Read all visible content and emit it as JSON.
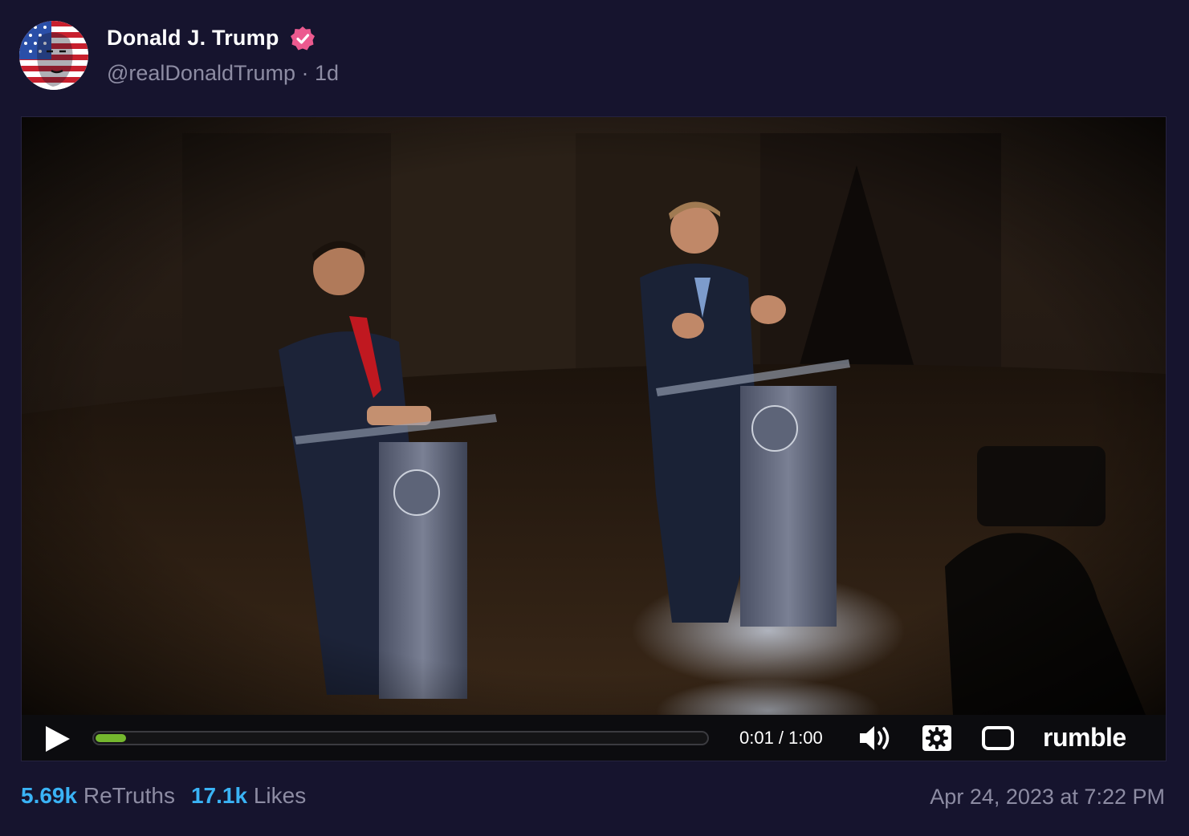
{
  "post": {
    "author": {
      "display_name": "Donald J. Trump",
      "handle": "@realDonaldTrump",
      "time_ago": "1d",
      "separator": "·",
      "verified": true,
      "verified_color": "#ec5a8f",
      "avatar_icon": "flag-face-avatar"
    },
    "video": {
      "current_time": "0:01",
      "duration": "1:00",
      "time_separator": "/",
      "progress_fraction": 0.017,
      "progress_color": "#74b72e",
      "brand": "rumble",
      "icons": {
        "play": "play-icon",
        "volume": "volume-icon",
        "settings": "gear-icon",
        "fullscreen": "fullscreen-icon"
      }
    },
    "stats": {
      "retruths_count": "5.69k",
      "retruths_label": "ReTruths",
      "likes_count": "17.1k",
      "likes_label": "Likes",
      "accent_color": "#3ab3f5"
    },
    "timestamp": "Apr 24, 2023 at 7:22 PM"
  },
  "theme": {
    "background": "#16142e",
    "muted_text": "#8d8ca3"
  }
}
